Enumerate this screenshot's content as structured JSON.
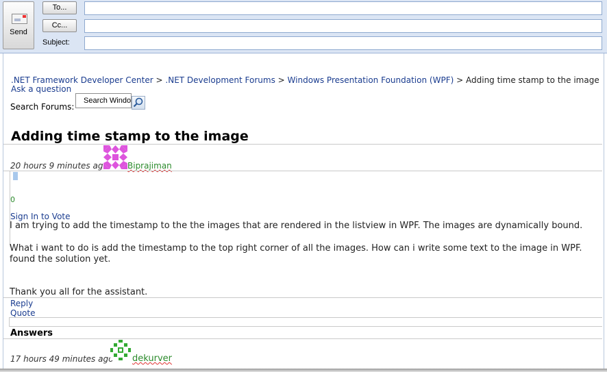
{
  "compose": {
    "send_label": "Send",
    "to_label": "To...",
    "cc_label": "Cc...",
    "subject_label": "Subject:",
    "to_value": "",
    "cc_value": "",
    "subject_value": ""
  },
  "breadcrumb": {
    "items": [
      ".NET Framework Developer Center",
      ".NET Development Forums",
      "Windows Presentation Foundation (WPF)"
    ],
    "separator": ">",
    "current": "Adding time stamp to the image"
  },
  "ask_link": "Ask a question",
  "search": {
    "label": "Search Forums:",
    "value": "Search Windo"
  },
  "thread": {
    "title": "Adding time stamp to the image",
    "post": {
      "time": "20 hours 9 minutes ago",
      "author": "Biprajiman",
      "vote_count": "0",
      "sign_in": "Sign In to Vote",
      "lines": [
        "I am trying to add the timestamp to the the images that are rendered in the listview in WPF. The images are dynamically bound.",
        "What i want to do is add the timestamp to the top right corner of all the images. How can i write some text to the image in WPF.",
        "found the solution yet.",
        "Thank you all for the assistant."
      ],
      "reply": "Reply",
      "quote": "Quote"
    }
  },
  "answers": {
    "heading": "Answers",
    "first": {
      "time": "17 hours 49 minutes ago",
      "author": "dekurver"
    }
  },
  "colors": {
    "link": "#1a3c8f",
    "author": "#2b8a2b",
    "compose_bg": "#dbe5f4",
    "avatar1": "#dd55dd",
    "avatar2": "#33aa33"
  }
}
